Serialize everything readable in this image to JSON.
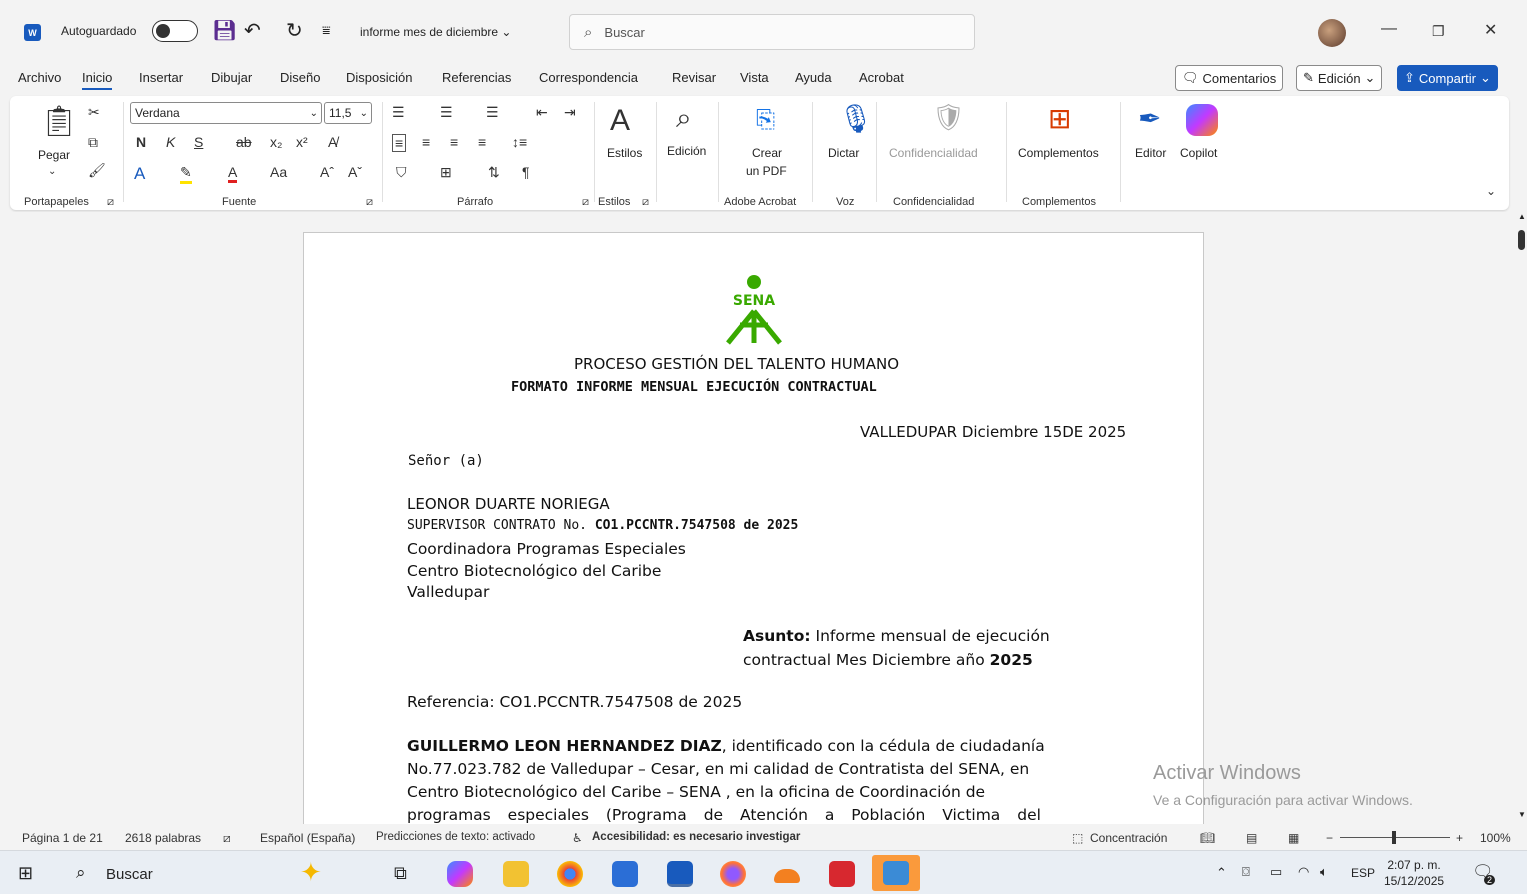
{
  "titlebar": {
    "autosave_label": "Autoguardado",
    "doc_title": "informe mes de diciembre",
    "search_placeholder": "Buscar"
  },
  "menu": [
    "Archivo",
    "Inicio",
    "Insertar",
    "Dibujar",
    "Diseño",
    "Disposición",
    "Referencias",
    "Correspondencia",
    "Revisar",
    "Vista",
    "Ayuda",
    "Acrobat"
  ],
  "menu_right": {
    "comments": "Comentarios",
    "editing": "Edición",
    "share": "Compartir"
  },
  "ribbon": {
    "paste": "Pegar",
    "font_name": "Verdana",
    "font_size": "11,5",
    "styles": "Estilos",
    "editing": "Edición",
    "create_pdf_1": "Crear",
    "create_pdf_2": "un PDF",
    "dictate": "Dictar",
    "confidentiality": "Confidencialidad",
    "addins": "Complementos",
    "editor": "Editor",
    "copilot": "Copilot",
    "groups": {
      "clipboard": "Portapapeles",
      "font": "Fuente",
      "paragraph": "Párrafo",
      "styles": "Estilos",
      "adobe": "Adobe Acrobat",
      "voice": "Voz",
      "confidentiality": "Confidencialidad",
      "addins": "Complementos"
    }
  },
  "document": {
    "logo_text": "SENA",
    "heading1": "PROCESO GESTIÓN DEL TALENTO HUMANO",
    "heading2": "FORMATO INFORME MENSUAL EJECUCIÓN CONTRACTUAL",
    "date_line": "VALLEDUPAR Diciembre 15DE 2025",
    "salutation": "Señor (a)",
    "addressee_name": "LEONOR DUARTE NORIEGA",
    "addressee_role_prefix": "SUPERVISOR CONTRATO No.",
    "addressee_contract": "CO1.PCCNTR.7547508 de 2025",
    "addressee_line3": "Coordinadora Programas Especiales",
    "addressee_line4": "Centro Biotecnológico del Caribe",
    "addressee_line5": "Valledupar",
    "subject_label": "Asunto:",
    "subject_text1": "Informe mensual de ejecución",
    "subject_text2": "contractual Mes Diciembre año",
    "subject_year": "2025",
    "reference": "Referencia: CO1.PCCNTR.7547508 de 2025",
    "body_name": "GUILLERMO LEON HERNANDEZ DIAZ",
    "body_line1_rest": ", identificado con la cédula de ciudadanía",
    "body_line2": "No.77.023.782 de Valledupar – Cesar, en mi calidad de Contratista del SENA, en",
    "body_line3": "Centro Biotecnológico del Caribe – SENA , en la oficina de Coordinación de",
    "body_line4": "programas especiales (Programa de Atención a Población Victima del"
  },
  "watermark": {
    "line1": "Activar Windows",
    "line2": "Ve a Configuración para activar Windows."
  },
  "status": {
    "page": "Página 1 de 21",
    "words": "2618 palabras",
    "language": "Español (España)",
    "predictions": "Predicciones de texto: activado",
    "accessibility": "Accesibilidad: es necesario investigar",
    "focus": "Concentración",
    "zoom": "100%"
  },
  "taskbar": {
    "search": "Buscar",
    "lang": "ESP",
    "time": "2:07 p. m.",
    "date": "15/12/2025",
    "badge": "2"
  }
}
